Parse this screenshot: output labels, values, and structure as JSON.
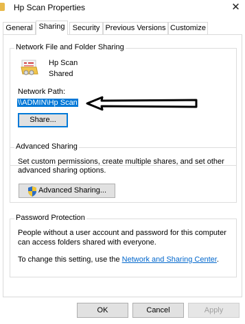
{
  "window": {
    "title": "Hp Scan Properties",
    "close_glyph": "✕"
  },
  "tabs": [
    {
      "label": "General"
    },
    {
      "label": "Sharing",
      "active": true
    },
    {
      "label": "Security"
    },
    {
      "label": "Previous Versions"
    },
    {
      "label": "Customize"
    }
  ],
  "network_sharing": {
    "heading": "Network File and Folder Sharing",
    "folder_name": "Hp Scan",
    "share_status": "Shared",
    "network_path_label": "Network Path:",
    "network_path_value": "\\\\ADMIN\\Hp Scan",
    "share_button": "Share..."
  },
  "advanced_sharing": {
    "heading": "Advanced Sharing",
    "description_line1": "Set custom permissions, create multiple shares, and set other",
    "description_line2": "advanced sharing options.",
    "button": "Advanced Sharing..."
  },
  "password_protection": {
    "heading": "Password Protection",
    "description_line1": "People without a user account and password for this computer",
    "description_line2": "can access folders shared with everyone.",
    "change_prefix": "To change this setting, use the ",
    "link_text": "Network and Sharing Center",
    "change_suffix": "."
  },
  "footer": {
    "ok": "OK",
    "cancel": "Cancel",
    "apply": "Apply"
  },
  "colors": {
    "selection": "#0078d7",
    "link": "#0066cc",
    "accent_focus": "#0078d7"
  },
  "icons": [
    "folder-icon",
    "close-icon",
    "shared-folder-icon",
    "uac-shield-icon",
    "annotation-arrow-icon"
  ]
}
